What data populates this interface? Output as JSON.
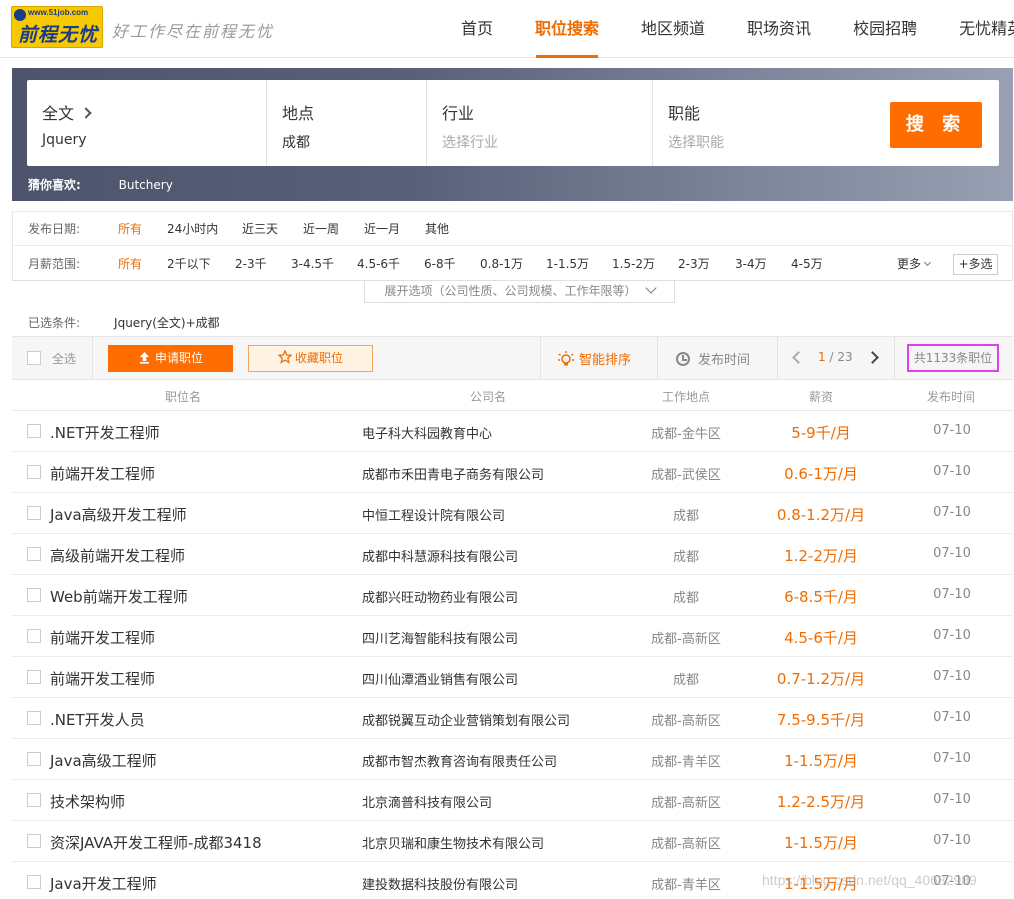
{
  "header": {
    "logo_url": "www.51job.com",
    "logo_name": "前程无忧",
    "slogan": "好工作尽在前程无忧",
    "nav": [
      {
        "label": "首页",
        "active": false
      },
      {
        "label": "职位搜索",
        "active": true
      },
      {
        "label": "地区频道",
        "active": false
      },
      {
        "label": "职场资讯",
        "active": false
      },
      {
        "label": "校园招聘",
        "active": false
      },
      {
        "label": "无忧精英",
        "active": false
      }
    ]
  },
  "search": {
    "fulltext_label": "全文",
    "fulltext_value": "Jquery",
    "location_label": "地点",
    "location_value": "成都",
    "industry_label": "行业",
    "industry_placeholder": "选择行业",
    "function_label": "职能",
    "function_placeholder": "选择职能",
    "button_label": "搜 索",
    "guess_label": "猜你喜欢:",
    "guess_value": "Butchery"
  },
  "filters": {
    "date_label": "发布日期:",
    "date_options": [
      "所有",
      "24小时内",
      "近三天",
      "近一周",
      "近一月",
      "其他"
    ],
    "salary_label": "月薪范围:",
    "salary_options": [
      "所有",
      "2千以下",
      "2-3千",
      "3-4.5千",
      "4.5-6千",
      "6-8千",
      "0.8-1万",
      "1-1.5万",
      "1.5-2万",
      "2-3万",
      "3-4万",
      "4-5万"
    ],
    "more_label": "更多",
    "multi_label": "+多选",
    "expand_label": "展开选项（公司性质、公司规模、工作年限等）",
    "selected_label": "已选条件:",
    "selected_value": "Jquery(全文)+成都"
  },
  "toolbar": {
    "select_all": "全选",
    "apply": "申请职位",
    "favorite": "收藏职位",
    "smart_sort": "智能排序",
    "pub_time": "发布时间",
    "page_current": "1",
    "page_total": "/ 23",
    "total": "共1133条职位",
    "highlight_color": "#e040e6"
  },
  "table": {
    "headers": [
      "职位名",
      "公司名",
      "工作地点",
      "薪资",
      "发布时间"
    ],
    "rows": [
      {
        "job": ".NET开发工程师",
        "company": "电子科大科园教育中心",
        "location": "成都-金牛区",
        "salary": "5-9千/月",
        "date": "07-10"
      },
      {
        "job": "前端开发工程师",
        "company": "成都市禾田青电子商务有限公司",
        "location": "成都-武侯区",
        "salary": "0.6-1万/月",
        "date": "07-10"
      },
      {
        "job": "Java高级开发工程师",
        "company": "中恒工程设计院有限公司",
        "location": "成都",
        "salary": "0.8-1.2万/月",
        "date": "07-10"
      },
      {
        "job": "高级前端开发工程师",
        "company": "成都中科慧源科技有限公司",
        "location": "成都",
        "salary": "1.2-2万/月",
        "date": "07-10"
      },
      {
        "job": "Web前端开发工程师",
        "company": "成都兴旺动物药业有限公司",
        "location": "成都",
        "salary": "6-8.5千/月",
        "date": "07-10"
      },
      {
        "job": "前端开发工程师",
        "company": "四川艺海智能科技有限公司",
        "location": "成都-高新区",
        "salary": "4.5-6千/月",
        "date": "07-10"
      },
      {
        "job": "前端开发工程师",
        "company": "四川仙潭酒业销售有限公司",
        "location": "成都",
        "salary": "0.7-1.2万/月",
        "date": "07-10"
      },
      {
        "job": ".NET开发人员",
        "company": "成都锐翼互动企业营销策划有限公司",
        "location": "成都-高新区",
        "salary": "7.5-9.5千/月",
        "date": "07-10"
      },
      {
        "job": "Java高级工程师",
        "company": "成都市智杰教育咨询有限责任公司",
        "location": "成都-青羊区",
        "salary": "1-1.5万/月",
        "date": "07-10"
      },
      {
        "job": "技术架构师",
        "company": "北京滴普科技有限公司",
        "location": "成都-高新区",
        "salary": "1.2-2.5万/月",
        "date": "07-10"
      },
      {
        "job": "资深JAVA开发工程师-成都3418",
        "company": "北京贝瑞和康生物技术有限公司",
        "location": "成都-高新区",
        "salary": "1-1.5万/月",
        "date": "07-10"
      },
      {
        "job": "Java开发工程师",
        "company": "建投数据科技股份有限公司",
        "location": "成都-青羊区",
        "salary": "1-1.5万/月",
        "date": "07-10"
      }
    ]
  },
  "watermark": "https://blog.csdn.net/qq_40682989",
  "colors": {
    "accent": "#f06c00",
    "button": "#ff6d00"
  }
}
